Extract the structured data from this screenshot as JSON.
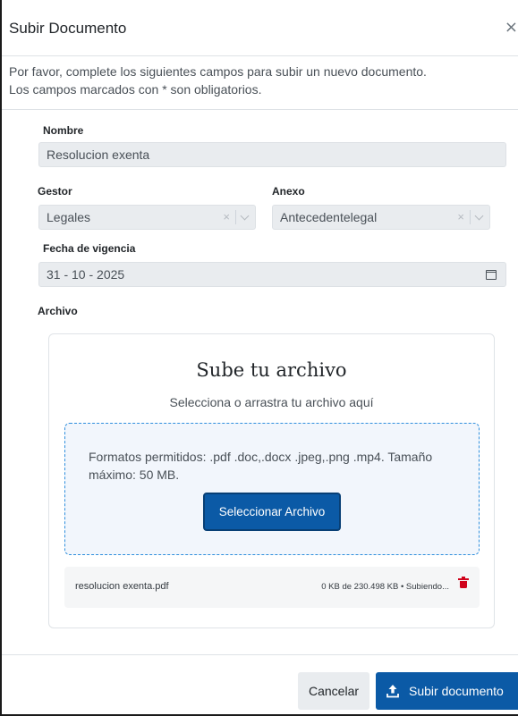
{
  "modal": {
    "title": "Subir Documento",
    "close_symbol": "×",
    "intro_line1": "Por favor, complete los siguientes campos para subir un nuevo documento.",
    "intro_line2": "Los campos marcados con * son obligatorios."
  },
  "form": {
    "nombre": {
      "label": "Nombre",
      "value": "Resolucion exenta"
    },
    "gestor": {
      "label": "Gestor",
      "value": "Legales",
      "clear_symbol": "×"
    },
    "anexo": {
      "label": "Anexo",
      "value": "Antecedentelegal",
      "clear_symbol": "×"
    },
    "fecha": {
      "label": "Fecha de vigencia",
      "value": "31 - 10 - 2025"
    },
    "archivo": {
      "label": "Archivo"
    }
  },
  "upload": {
    "title": "Sube tu archivo",
    "subtitle": "Selecciona o arrastra tu archivo aquí",
    "formats": "Formatos permitidos: .pdf .doc,.docx .jpeg,.png .mp4. Tamaño máximo: 50 MB.",
    "select_button": "Seleccionar Archivo",
    "file": {
      "name": "resolucion exenta.pdf",
      "status": "0 KB de 230.498 KB • Subiendo..."
    }
  },
  "footer": {
    "cancel_label": "Cancelar",
    "submit_label": "Subir documento"
  },
  "colors": {
    "primary": "#0b5aa6",
    "danger": "#d0021b",
    "dropzone_border": "#2f8fdd"
  },
  "icons": [
    "close-icon",
    "chevron-down-icon",
    "calendar-icon",
    "trash-icon",
    "upload-icon"
  ]
}
